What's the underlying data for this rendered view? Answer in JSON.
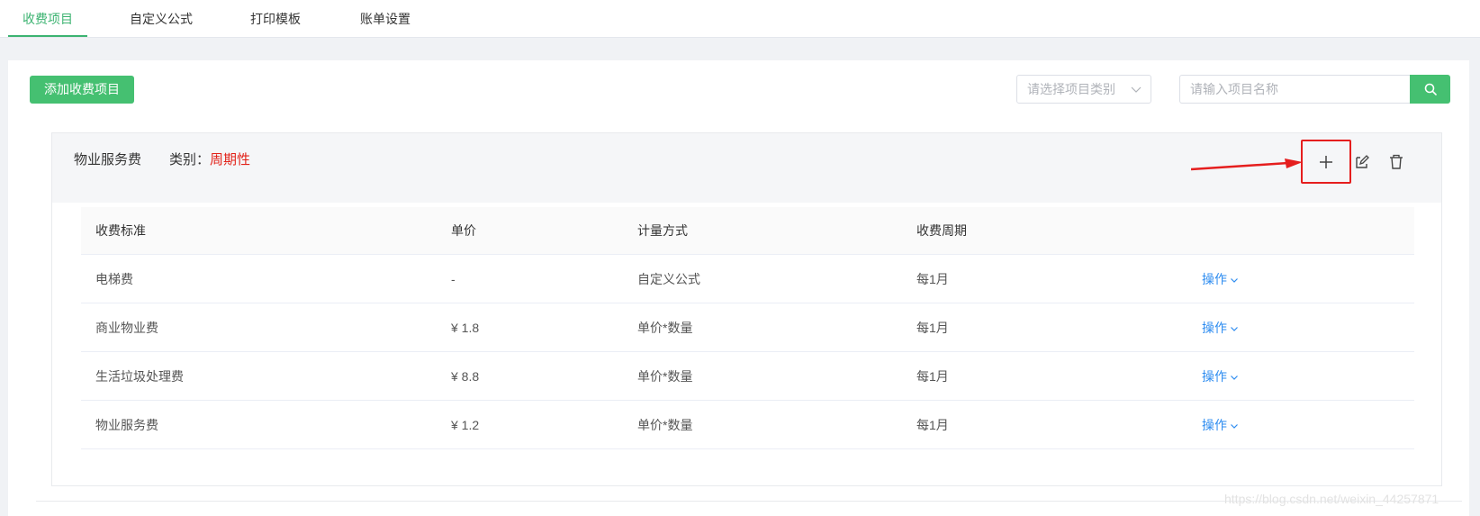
{
  "tabs": [
    {
      "label": "收费项目",
      "active": true
    },
    {
      "label": "自定义公式",
      "active": false
    },
    {
      "label": "打印模板",
      "active": false
    },
    {
      "label": "账单设置",
      "active": false
    }
  ],
  "toolbar": {
    "add_label": "添加收费项目",
    "category_placeholder": "请选择项目类别",
    "search_placeholder": "请输入项目名称"
  },
  "card": {
    "title": "物业服务费",
    "category_label": "类别：",
    "category_value": "周期性"
  },
  "table": {
    "headers": [
      "收费标准",
      "单价",
      "计量方式",
      "收费周期"
    ],
    "rows": [
      {
        "name": "电梯费",
        "price": "-",
        "method": "自定义公式",
        "cycle": "每1月",
        "op": "操作"
      },
      {
        "name": "商业物业费",
        "price": "¥ 1.8",
        "method": "单价*数量",
        "cycle": "每1月",
        "op": "操作"
      },
      {
        "name": "生活垃圾处理费",
        "price": "¥ 8.8",
        "method": "单价*数量",
        "cycle": "每1月",
        "op": "操作"
      },
      {
        "name": "物业服务费",
        "price": "¥ 1.2",
        "method": "单价*数量",
        "cycle": "每1月",
        "op": "操作"
      }
    ]
  },
  "watermark": "https://blog.csdn.net/weixin_44257871",
  "colors": {
    "accent": "#45c071",
    "link": "#2d8cf0",
    "danger": "#e2231a",
    "highlight": "#e51e1e"
  },
  "icons": [
    "chevron-down-icon",
    "search-icon",
    "plus-icon",
    "edit-icon",
    "trash-icon",
    "arrow-annotation"
  ]
}
